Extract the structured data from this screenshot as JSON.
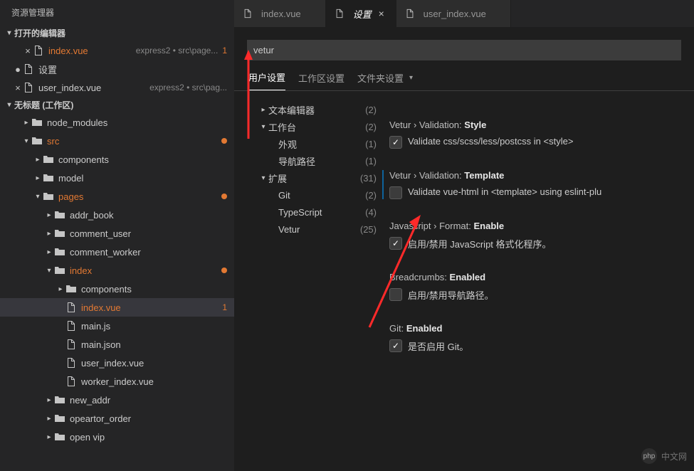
{
  "explorer": {
    "title": "资源管理器",
    "openEditors": {
      "header": "打开的编辑器",
      "items": [
        {
          "name": "index.vue",
          "path": "express2 • src\\page...",
          "badge": "1",
          "modified": false,
          "highlight": true
        },
        {
          "name": "设置",
          "path": "",
          "badge": "",
          "modified": true,
          "highlight": false
        },
        {
          "name": "user_index.vue",
          "path": "express2 • src\\pag...",
          "badge": "",
          "modified": false,
          "highlight": false
        }
      ]
    },
    "workspace": {
      "header": "无标题 (工作区)",
      "tree": [
        {
          "name": "node_modules",
          "type": "folder",
          "depth": 1,
          "expanded": false
        },
        {
          "name": "src",
          "type": "folder-open",
          "depth": 1,
          "expanded": true,
          "highlight": true,
          "dot": true
        },
        {
          "name": "components",
          "type": "folder",
          "depth": 2,
          "expanded": false
        },
        {
          "name": "model",
          "type": "folder",
          "depth": 2,
          "expanded": false
        },
        {
          "name": "pages",
          "type": "folder-open",
          "depth": 2,
          "expanded": true,
          "highlight": true,
          "dot": true
        },
        {
          "name": "addr_book",
          "type": "folder",
          "depth": 3,
          "expanded": false
        },
        {
          "name": "comment_user",
          "type": "folder",
          "depth": 3,
          "expanded": false
        },
        {
          "name": "comment_worker",
          "type": "folder",
          "depth": 3,
          "expanded": false
        },
        {
          "name": "index",
          "type": "folder-open",
          "depth": 3,
          "expanded": true,
          "highlight": true,
          "dot": true
        },
        {
          "name": "components",
          "type": "folder",
          "depth": 4,
          "expanded": false
        },
        {
          "name": "index.vue",
          "type": "file",
          "depth": 4,
          "highlight": true,
          "badge": "1",
          "selected": true
        },
        {
          "name": "main.js",
          "type": "file",
          "depth": 4
        },
        {
          "name": "main.json",
          "type": "file",
          "depth": 4
        },
        {
          "name": "user_index.vue",
          "type": "file",
          "depth": 4
        },
        {
          "name": "worker_index.vue",
          "type": "file",
          "depth": 4
        },
        {
          "name": "new_addr",
          "type": "folder",
          "depth": 3,
          "expanded": false
        },
        {
          "name": "opeartor_order",
          "type": "folder",
          "depth": 3,
          "expanded": false
        },
        {
          "name": "open vip",
          "type": "folder",
          "depth": 3,
          "expanded": false
        }
      ]
    }
  },
  "tabs": [
    {
      "name": "index.vue",
      "active": false,
      "italic": false
    },
    {
      "name": "设置",
      "active": true,
      "italic": true,
      "close": "×"
    },
    {
      "name": "user_index.vue",
      "active": false,
      "italic": false
    }
  ],
  "settings": {
    "searchValue": "vetur",
    "sub_tabs": {
      "user": "用户设置",
      "workspace": "工作区设置",
      "folder": "文件夹设置"
    },
    "toc": [
      {
        "label": "文本编辑器",
        "count": "(2)",
        "depth": 0,
        "twisty": "▸"
      },
      {
        "label": "工作台",
        "count": "(2)",
        "depth": 0,
        "twisty": "▾"
      },
      {
        "label": "外观",
        "count": "(1)",
        "depth": 1,
        "twisty": ""
      },
      {
        "label": "导航路径",
        "count": "(1)",
        "depth": 1,
        "twisty": ""
      },
      {
        "label": "扩展",
        "count": "(31)",
        "depth": 0,
        "twisty": "▾"
      },
      {
        "label": "Git",
        "count": "(2)",
        "depth": 1,
        "twisty": ""
      },
      {
        "label": "TypeScript",
        "count": "(4)",
        "depth": 1,
        "twisty": ""
      },
      {
        "label": "Vetur",
        "count": "(25)",
        "depth": 1,
        "twisty": ""
      }
    ],
    "items": [
      {
        "path": "Vetur › Validation:",
        "key": "Style",
        "desc": "Validate css/scss/less/postcss in <style>",
        "checked": true,
        "highlight": false
      },
      {
        "path": "Vetur › Validation:",
        "key": "Template",
        "desc": "Validate vue-html in <template> using eslint-plu",
        "checked": false,
        "highlight": true
      },
      {
        "path": "Javascript › Format:",
        "key": "Enable",
        "desc": "启用/禁用 JavaScript 格式化程序。",
        "checked": true,
        "highlight": false
      },
      {
        "path": "Breadcrumbs:",
        "key": "Enabled",
        "desc": "启用/禁用导航路径。",
        "checked": false,
        "highlight": false
      },
      {
        "path": "Git:",
        "key": "Enabled",
        "desc": "是否启用 Git。",
        "checked": true,
        "highlight": false
      }
    ]
  },
  "watermark": {
    "text": "中文网",
    "prefix": "php"
  }
}
